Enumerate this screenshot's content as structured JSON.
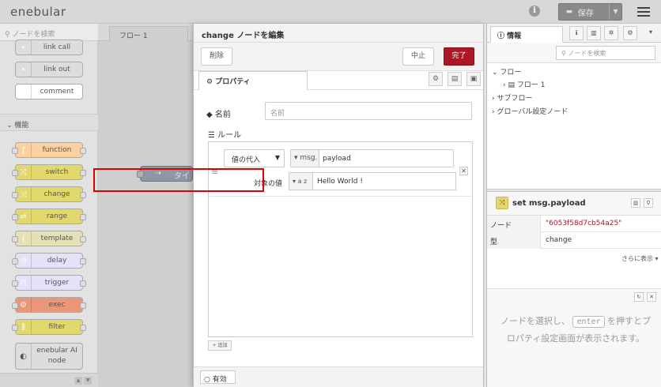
{
  "header": {
    "logo": "enebular",
    "info_icon": "i",
    "deploy_label": "保存",
    "deploy_icon": "deploy-icon",
    "menu_icon": "hamburger-icon"
  },
  "palette": {
    "search_placeholder": "ノードを検索",
    "category_label": "機能",
    "nodes_top": [
      {
        "label": "link call",
        "color": "#dddddd"
      },
      {
        "label": "link out",
        "color": "#dddddd"
      },
      {
        "label": "comment",
        "color": "#ffffff"
      }
    ],
    "nodes": [
      {
        "label": "function",
        "color": "#fdd0a2"
      },
      {
        "label": "switch",
        "color": "#e2d96e"
      },
      {
        "label": "change",
        "color": "#e2d96e"
      },
      {
        "label": "range",
        "color": "#e2d96e"
      },
      {
        "label": "template",
        "color": "#e6e0b7"
      },
      {
        "label": "delay",
        "color": "#e6e0f8"
      },
      {
        "label": "trigger",
        "color": "#e6e0f8"
      },
      {
        "label": "exec",
        "color": "#e9967a"
      },
      {
        "label": "filter",
        "color": "#e2d96e"
      }
    ],
    "ai_node": {
      "line1": "enebular AI",
      "line2": "node"
    }
  },
  "workspace": {
    "tab_label": "フロー 1",
    "canvas_node_label": "タイ"
  },
  "editor": {
    "title": "change ノードを編集",
    "delete_label": "削除",
    "cancel_label": "中止",
    "done_label": "完了",
    "tab_label": "プロパティ",
    "name_label": "名前",
    "name_placeholder": "名前",
    "rules_label": "ルール",
    "rule": {
      "action": "値の代入",
      "prop_type": "msg.",
      "prop_value": "payload",
      "to_label": "対象の値",
      "to_type": "a z",
      "to_value": "Hello World !"
    },
    "add_label": "+ 追加",
    "enabled_label": "有効"
  },
  "sidebar": {
    "tab_label": "情報",
    "search_placeholder": "ノードを検索",
    "tree": {
      "flows": "フロー",
      "flow1": "フロー 1",
      "subflows": "サブフロー",
      "global": "グローバル設定ノード"
    },
    "selected": {
      "name": "set msg.payload",
      "rows": [
        {
          "key": "ノード",
          "value": "\"6053f58d7cb54a25\"",
          "color": "#ad1625"
        },
        {
          "key": "型",
          "value": "change",
          "color": "#333333"
        }
      ],
      "more_label": "さらに表示 ▾"
    },
    "help": {
      "text_before": "ノードを選択し、",
      "kbd": "enter",
      "text_after": "を押すとプロパティ設定画面が表示されます。"
    }
  }
}
